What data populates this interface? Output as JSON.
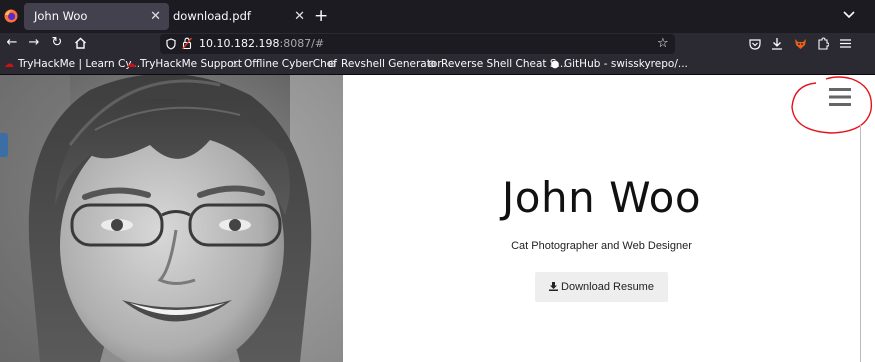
{
  "browser": {
    "tabs": [
      {
        "label": "John Woo",
        "active": true
      },
      {
        "label": "download.pdf",
        "active": false
      }
    ],
    "new_tab_glyph": "+",
    "close_glyph": "✕",
    "url_host": "10.10.182.198",
    "url_rest": ":8087/#",
    "bookmarks": [
      {
        "label": "TryHackMe | Learn Cy...",
        "icon": "tryhackme-icon"
      },
      {
        "label": "TryHackMe Support",
        "icon": "tryhackme-icon"
      },
      {
        "label": "Offline CyberChef",
        "icon": "chef-hat-icon"
      },
      {
        "label": "Revshell Generator",
        "icon": "globe-icon"
      },
      {
        "label": "Reverse Shell Cheat S...",
        "icon": "globe-icon"
      },
      {
        "label": "GitHub - swisskyrepo/...",
        "icon": "github-icon"
      }
    ]
  },
  "site": {
    "name": "John Woo",
    "tagline": "Cat Photographer and Web Designer",
    "download_label": "Download Resume"
  },
  "colors": {
    "annotation": "#e4121b",
    "button_bg": "#eeeeee",
    "hamburger": "#666666"
  }
}
